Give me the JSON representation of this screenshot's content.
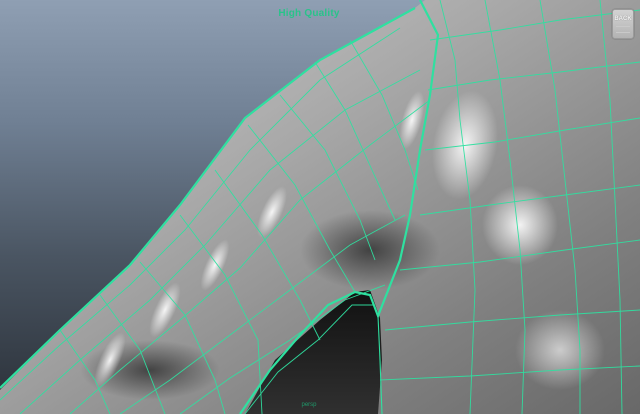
{
  "viewport": {
    "hud_title": "High Quality",
    "camera_label": "persp",
    "viewcube_label": "BACK",
    "wireframe_color": "#2fe0a0",
    "background_top": "#8f9fb3",
    "background_bottom": "#2a3038"
  }
}
